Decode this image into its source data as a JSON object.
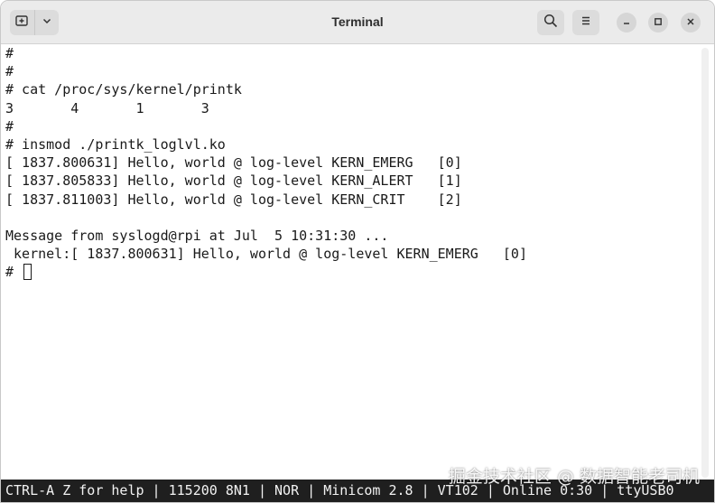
{
  "window": {
    "title": "Terminal"
  },
  "icons": {
    "new_tab": "new-tab-icon",
    "menu_dropdown": "chevron-down-icon",
    "search": "search-icon",
    "menu": "hamburger-menu-icon",
    "minimize": "minimize-icon",
    "maximize": "maximize-icon",
    "close": "close-icon"
  },
  "terminal": {
    "lines": [
      "#",
      "#",
      "# cat /proc/sys/kernel/printk",
      "3       4       1       3",
      "#",
      "# insmod ./printk_loglvl.ko",
      "[ 1837.800631] Hello, world @ log-level KERN_EMERG   [0]",
      "[ 1837.805833] Hello, world @ log-level KERN_ALERT   [1]",
      "[ 1837.811003] Hello, world @ log-level KERN_CRIT    [2]",
      "",
      "Message from syslogd@rpi at Jul  5 10:31:30 ...",
      " kernel:[ 1837.800631] Hello, world @ log-level KERN_EMERG   [0]"
    ],
    "prompt": "# "
  },
  "statusbar": {
    "text": "CTRL-A Z for help | 115200 8N1 | NOR | Minicom 2.8 | VT102 | Online 0:30 | ttyUSB0"
  },
  "watermark": {
    "text": "掘金技术社区 @ 数据智能老司机"
  },
  "colors": {
    "titlebar_bg": "#ebebeb",
    "terminal_bg": "#ffffff",
    "terminal_fg": "#1a1a1a",
    "statusbar_bg": "#1f1f1f",
    "statusbar_fg": "#f2f2f2"
  }
}
